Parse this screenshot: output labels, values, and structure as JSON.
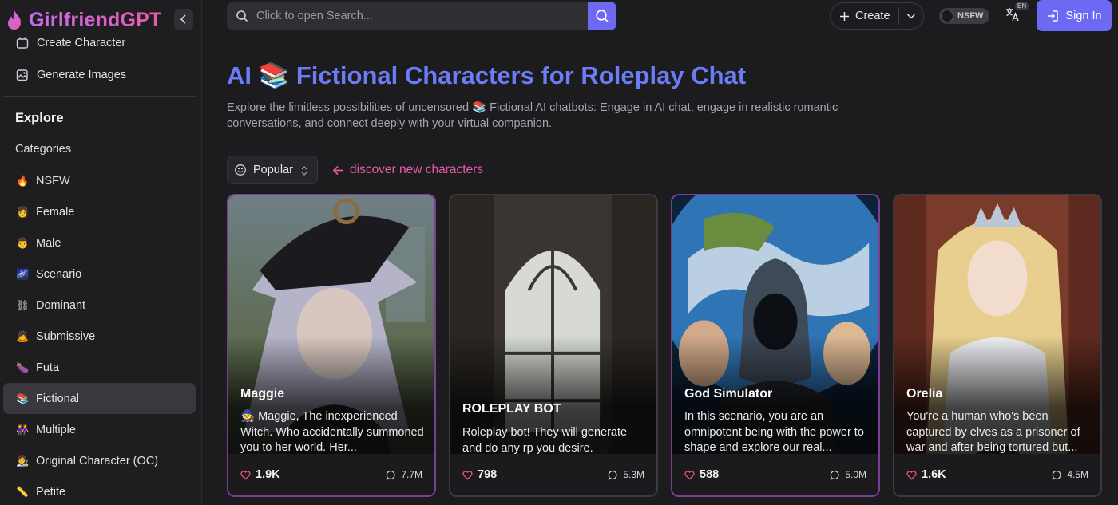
{
  "brand": {
    "name": "GirlfriendGPT"
  },
  "sidebar": {
    "top_links": [
      {
        "label": "Create Character",
        "icon": "create-character-icon"
      },
      {
        "label": "Generate Images",
        "icon": "image-edit-icon"
      }
    ],
    "explore_title": "Explore",
    "categories_title": "Categories",
    "categories": [
      {
        "label": "NSFW",
        "icon": "🔥"
      },
      {
        "label": "Female",
        "icon": "👩"
      },
      {
        "label": "Male",
        "icon": "👨"
      },
      {
        "label": "Scenario",
        "icon": "🌌"
      },
      {
        "label": "Dominant",
        "icon": "⛓"
      },
      {
        "label": "Submissive",
        "icon": "🙇"
      },
      {
        "label": "Futa",
        "icon": "🍆"
      },
      {
        "label": "Fictional",
        "icon": "📚",
        "active": true
      },
      {
        "label": "Multiple",
        "icon": "👭"
      },
      {
        "label": "Original Character (OC)",
        "icon": "👩‍🎨"
      },
      {
        "label": "Petite",
        "icon": "📏"
      }
    ]
  },
  "header": {
    "search_placeholder": "Click to open Search...",
    "create_label": "Create",
    "nsfw_label": "NSFW",
    "nsfw_on": false,
    "lang_badge": "EN",
    "signin_label": "Sign In"
  },
  "main": {
    "title": "AI 📚 Fictional Characters for Roleplay Chat",
    "description": "Explore the limitless possibilities of uncensored 📚 Fictional AI chatbots: Engage in AI chat, engage in realistic romantic conversations, and connect deeply with your virtual companion.",
    "sort_label": "Popular",
    "discover_label": "discover new characters",
    "cards": [
      {
        "name": "Maggie",
        "description": "🧙 Maggie, The inexperienced Witch. Who accidentally summoned you to her world. Her...",
        "likes": "1.9K",
        "chats": "7.7M"
      },
      {
        "name": "ROLEPLAY BOT",
        "description": "Roleplay bot! They will generate and do any rp you desire.",
        "likes": "798",
        "chats": "5.3M"
      },
      {
        "name": "God Simulator",
        "description": "In this scenario, you are an omnipotent being with the power to shape and explore our real...",
        "likes": "588",
        "chats": "5.0M"
      },
      {
        "name": "Orelia",
        "description": "You're a human who's been captured by elves as a prisoner of war and after being tortured but...",
        "likes": "1.6K",
        "chats": "4.5M"
      }
    ]
  },
  "colors": {
    "accent": "#6d69f5",
    "title": "#6c7cf5",
    "brand_gradient_start": "#c56cf0",
    "brand_gradient_end": "#e85aa8",
    "discover": "#e85aa8",
    "like": "#f0566f"
  }
}
